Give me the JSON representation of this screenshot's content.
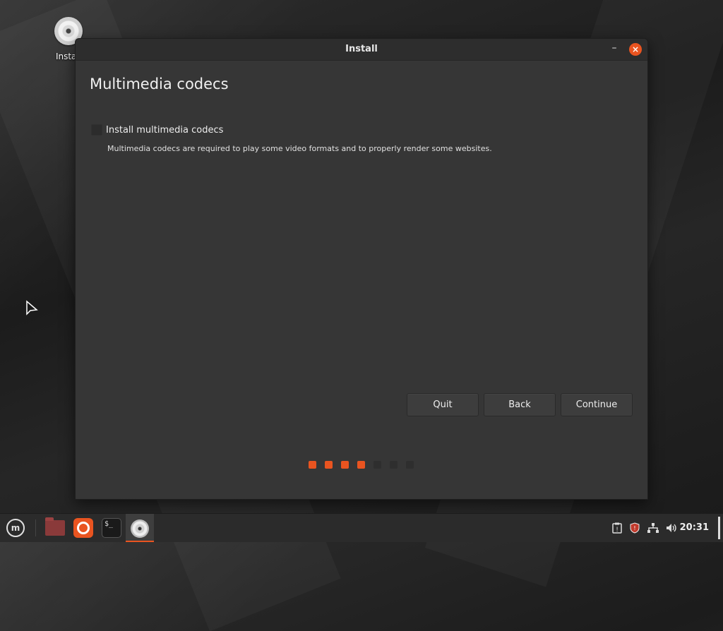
{
  "desktop": {
    "icon_label": "Install"
  },
  "window": {
    "title": "Install",
    "minimize_symbol": "–",
    "close_symbol": "×"
  },
  "page": {
    "heading": "Multimedia codecs",
    "option_label": "Install multimedia codecs",
    "option_checked": false,
    "option_description": "Multimedia codecs are required to play some video formats and to properly render some websites."
  },
  "buttons": {
    "quit": "Quit",
    "back": "Back",
    "continue": "Continue"
  },
  "progress": {
    "completed_steps": 4,
    "total_steps": 7,
    "active_color": "#e95420",
    "inactive_color": "#2e2e2e"
  },
  "taskbar": {
    "menu_icon": "mint-logo-icon",
    "apps": [
      "folder-icon",
      "firefox-icon",
      "terminal-icon",
      "installer-disc-icon"
    ],
    "terminal_glyph": "$_",
    "tray_icons": [
      "clipboard-icon",
      "shield-icon",
      "network-icon",
      "volume-icon"
    ],
    "clock": "20:31"
  }
}
